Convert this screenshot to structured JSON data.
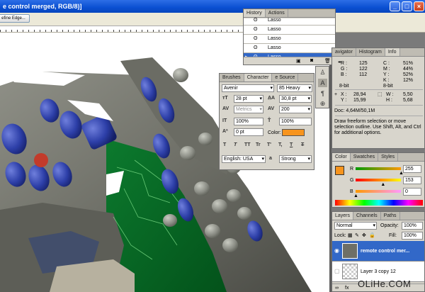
{
  "window": {
    "title": "e control merged, RGB/8)]"
  },
  "options_bar": {
    "refine_edge_label": "efine Edge..."
  },
  "history": {
    "tabs": [
      "History",
      "Actions"
    ],
    "items": [
      {
        "label": "Lasso",
        "selected": false
      },
      {
        "label": "Lasso",
        "selected": false
      },
      {
        "label": "Lasso",
        "selected": false
      },
      {
        "label": "Lasso",
        "selected": false
      },
      {
        "label": "Lasso",
        "selected": true
      }
    ]
  },
  "info_panel": {
    "tabs": [
      "avigator",
      "Histogram",
      "Info"
    ],
    "rgb": [
      {
        "k": "R :",
        "v": "125"
      },
      {
        "k": "G :",
        "v": "122"
      },
      {
        "k": "B :",
        "v": "112"
      }
    ],
    "cmyk": [
      {
        "k": "C :",
        "v": "51%"
      },
      {
        "k": "M :",
        "v": "44%"
      },
      {
        "k": "Y :",
        "v": "52%"
      },
      {
        "k": "K :",
        "v": "12%"
      }
    ],
    "bit_left": "8-bit",
    "bit_right": "8-bit",
    "x_label": "X :",
    "x_value": "28,94",
    "y_label": "Y :",
    "y_value": "15,99",
    "w_label": "W :",
    "w_value": "5,50",
    "h_label": "H :",
    "h_value": "5,68",
    "doc": "Doc: 4,64M/50,1M",
    "hint": [
      "Draw freeform selection or move",
      "selection outline. Use Shift, Alt, and Ctrl",
      "for additional options."
    ]
  },
  "color_panel": {
    "tabs": [
      "Color",
      "Swatches",
      "Styles"
    ],
    "r_label": "R",
    "r_value": "255",
    "g_label": "G",
    "g_value": "153",
    "b_label": "B",
    "b_value": "0",
    "fg_color": "#f7941d",
    "r_slider": 1.0,
    "g_slider": 0.6,
    "b_slider": 0.0
  },
  "layers_panel": {
    "tabs": [
      "Layers",
      "Channels",
      "Paths"
    ],
    "blend_mode": "Normal",
    "opacity_label": "Opacity:",
    "opacity_value": "100%",
    "lock_label": "Lock:",
    "fill_label": "Fill:",
    "fill_value": "100%",
    "layers": [
      {
        "name": "remote control mer...",
        "selected": true
      },
      {
        "name": "Layer 3 copy 12",
        "selected": false
      }
    ]
  },
  "character_panel": {
    "tabs": [
      "Brushes",
      "Character",
      "e Source"
    ],
    "font_family": "Avenir",
    "font_style": "85 Heavy",
    "font_size": "28 pt",
    "leading": "30,8 pt",
    "kerning": "Metrics",
    "tracking": "200",
    "vertical_scale": "100%",
    "horizontal_scale": "100%",
    "baseline_shift": "0 pt",
    "color_label": "Color:",
    "text_color": "#f7941d",
    "style_buttons": [
      "T",
      "T",
      "TT",
      "Tr",
      "T'",
      "T,",
      "T",
      "T"
    ],
    "language": "English: USA",
    "aa_label": "a",
    "antialias": "Strong"
  },
  "watermark": "OLiHe.COM"
}
